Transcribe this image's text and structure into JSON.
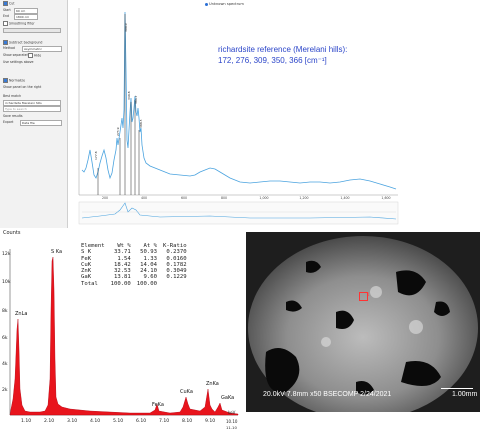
{
  "raman": {
    "sidebar": {
      "header_label": "Cut",
      "start_label": "Start",
      "start_value": "60 cm",
      "end_label": "End",
      "end_value": "1800 cm",
      "smoothing_label": "Smoothing filter",
      "subtract_bg_label": "Subtract background",
      "method_label": "Method",
      "method_value": "Asymmetric",
      "show_separately_label": "Show separately",
      "hide_label": "Hide",
      "use_settings_label": "Use settings above",
      "normalize_label": "Normalize",
      "show_panel_label": "Show panel on the right",
      "best_match_label": "Best match",
      "best_match_value": "richardsite Merelani hills",
      "filter_label": "Type to search",
      "save_results_label": "Save results",
      "export_label": "Export",
      "export_value": "Data file"
    },
    "legend_label": "Unknown spectrum",
    "reference_note": {
      "line1": "richardsite reference (Merelani hills):",
      "line2": "172, 276, 309, 350, 366 [cm⁻¹]"
    },
    "x_ticks": [
      "200",
      "400",
      "600",
      "800",
      "1,000",
      "1,200",
      "1,400",
      "1,600"
    ],
    "peak_labels": [
      "177.8",
      "275.9",
      "309.0",
      "349.8",
      "366.7",
      "388.5"
    ]
  },
  "eds": {
    "title": "Counts",
    "y_ticks": [
      "12k",
      "10k",
      "8k",
      "6k",
      "4k",
      "2k"
    ],
    "x_ticks": [
      "1.10",
      "2.10",
      "3.10",
      "4.10",
      "5.10",
      "6.10",
      "7.10",
      "8.10",
      "9.10",
      "10.10",
      "11.10"
    ],
    "x_unit": "keV",
    "peaks": {
      "s": "S Ka",
      "zn_l": "ZnLa",
      "fe": "FeKa",
      "cu": "CuKa",
      "zn_k": "ZnKa",
      "ga": "GaKa"
    },
    "table": {
      "headers": [
        "Element",
        "Wt %",
        "At %",
        "K-Ratio"
      ],
      "rows": [
        [
          "S K",
          "33.71",
          "50.93",
          "0.2370"
        ],
        [
          "FeK",
          "1.54",
          "1.33",
          "0.0160"
        ],
        [
          "CuK",
          "18.42",
          "14.04",
          "0.1782"
        ],
        [
          "ZnK",
          "32.53",
          "24.10",
          "0.3049"
        ],
        [
          "GaK",
          "13.81",
          "9.60",
          "0.1229"
        ],
        [
          "Total",
          "100.00",
          "100.00",
          ""
        ]
      ]
    }
  },
  "sem": {
    "info": "20.0kV 7.8mm x50 BSECOMP 2/24/2021",
    "scale_label": "1.00mm",
    "marker_label": "1",
    "colors": {
      "marker": "#ff3333"
    }
  },
  "colors": {
    "raman_line": "#4aa3df",
    "eds_fill": "#e8141c",
    "ref_text": "#2b45c9"
  }
}
